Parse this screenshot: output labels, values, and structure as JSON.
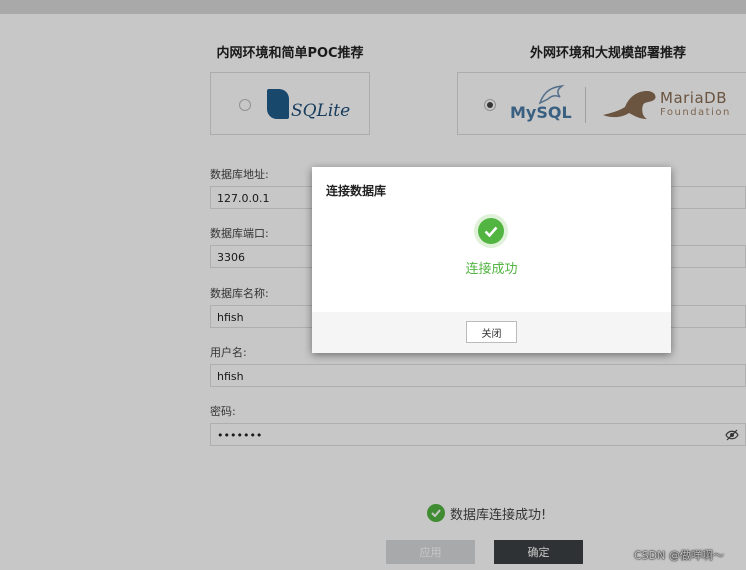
{
  "db_options": {
    "intranet_title": "内网环境和简单POC推荐",
    "external_title": "外网环境和大规模部署推荐",
    "sqlite": {
      "logo_text": "SQLite",
      "selected": false
    },
    "mysql": {
      "logo_text_my": "MySQL",
      "logo_text_reg": "",
      "selected": true
    },
    "mariadb": {
      "name": "MariaDB",
      "sub": "Foundation"
    }
  },
  "form": {
    "host_label": "数据库地址:",
    "host_value": "127.0.0.1",
    "port_label": "数据库端口:",
    "port_value": "3306",
    "dbname_label": "数据库名称:",
    "dbname_value": "hfish",
    "user_label": "用户名:",
    "user_value": "hfish",
    "password_label": "密码:",
    "password_value": "•••••••"
  },
  "status": {
    "text": "数据库连接成功!",
    "color": "#52b441"
  },
  "buttons": {
    "apply": "应用",
    "confirm": "确定"
  },
  "watermark": "CSDN @做咩啊～",
  "modal": {
    "title": "连接数据库",
    "message": "连接成功",
    "close": "关闭"
  },
  "colors": {
    "success": "#52b441",
    "primary_dark": "#3b4043"
  }
}
